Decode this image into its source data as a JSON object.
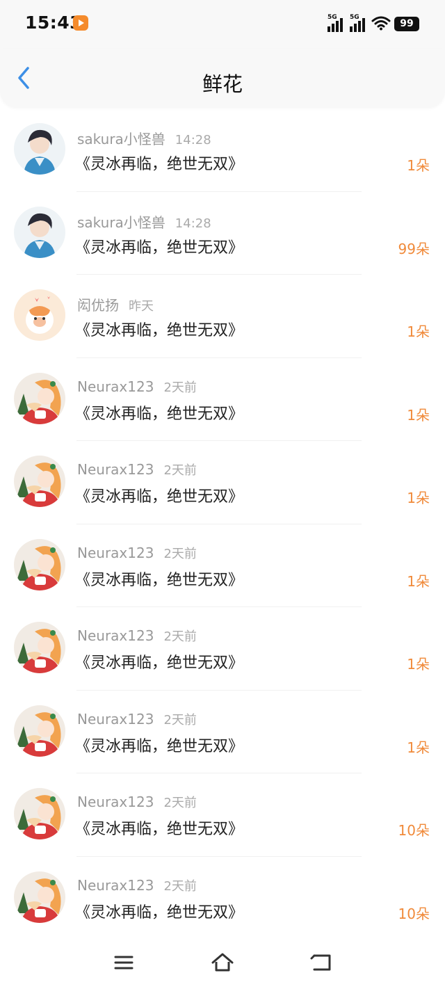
{
  "status_bar": {
    "time": "15:43",
    "signal_1": "5G",
    "signal_2": "5G",
    "battery": "99"
  },
  "header": {
    "title": "鲜花"
  },
  "accent_color": "#3c8fe6",
  "count_color": "#f08a3a",
  "items": [
    {
      "username": "sakura小怪兽",
      "time": "14:28",
      "book": "《灵冰再临，绝世无双》",
      "count": "1朵",
      "avatar": "avatar-boy"
    },
    {
      "username": "sakura小怪兽",
      "time": "14:28",
      "book": "《灵冰再临，绝世无双》",
      "count": "99朵",
      "avatar": "avatar-boy"
    },
    {
      "username": "闳优扬",
      "time": "昨天",
      "book": "《灵冰再临，绝世无双》",
      "count": "1朵",
      "avatar": "avatar-cat"
    },
    {
      "username": "Neurax123",
      "time": "2天前",
      "book": "《灵冰再临，绝世无双》",
      "count": "1朵",
      "avatar": "avatar-girl"
    },
    {
      "username": "Neurax123",
      "time": "2天前",
      "book": "《灵冰再临，绝世无双》",
      "count": "1朵",
      "avatar": "avatar-girl"
    },
    {
      "username": "Neurax123",
      "time": "2天前",
      "book": "《灵冰再临，绝世无双》",
      "count": "1朵",
      "avatar": "avatar-girl"
    },
    {
      "username": "Neurax123",
      "time": "2天前",
      "book": "《灵冰再临，绝世无双》",
      "count": "1朵",
      "avatar": "avatar-girl"
    },
    {
      "username": "Neurax123",
      "time": "2天前",
      "book": "《灵冰再临，绝世无双》",
      "count": "1朵",
      "avatar": "avatar-girl"
    },
    {
      "username": "Neurax123",
      "time": "2天前",
      "book": "《灵冰再临，绝世无双》",
      "count": "10朵",
      "avatar": "avatar-girl"
    },
    {
      "username": "Neurax123",
      "time": "2天前",
      "book": "《灵冰再临，绝世无双》",
      "count": "10朵",
      "avatar": "avatar-girl"
    }
  ],
  "nav": {
    "menu_icon": "menu-icon",
    "home_icon": "home-icon",
    "back_icon": "return-icon"
  }
}
